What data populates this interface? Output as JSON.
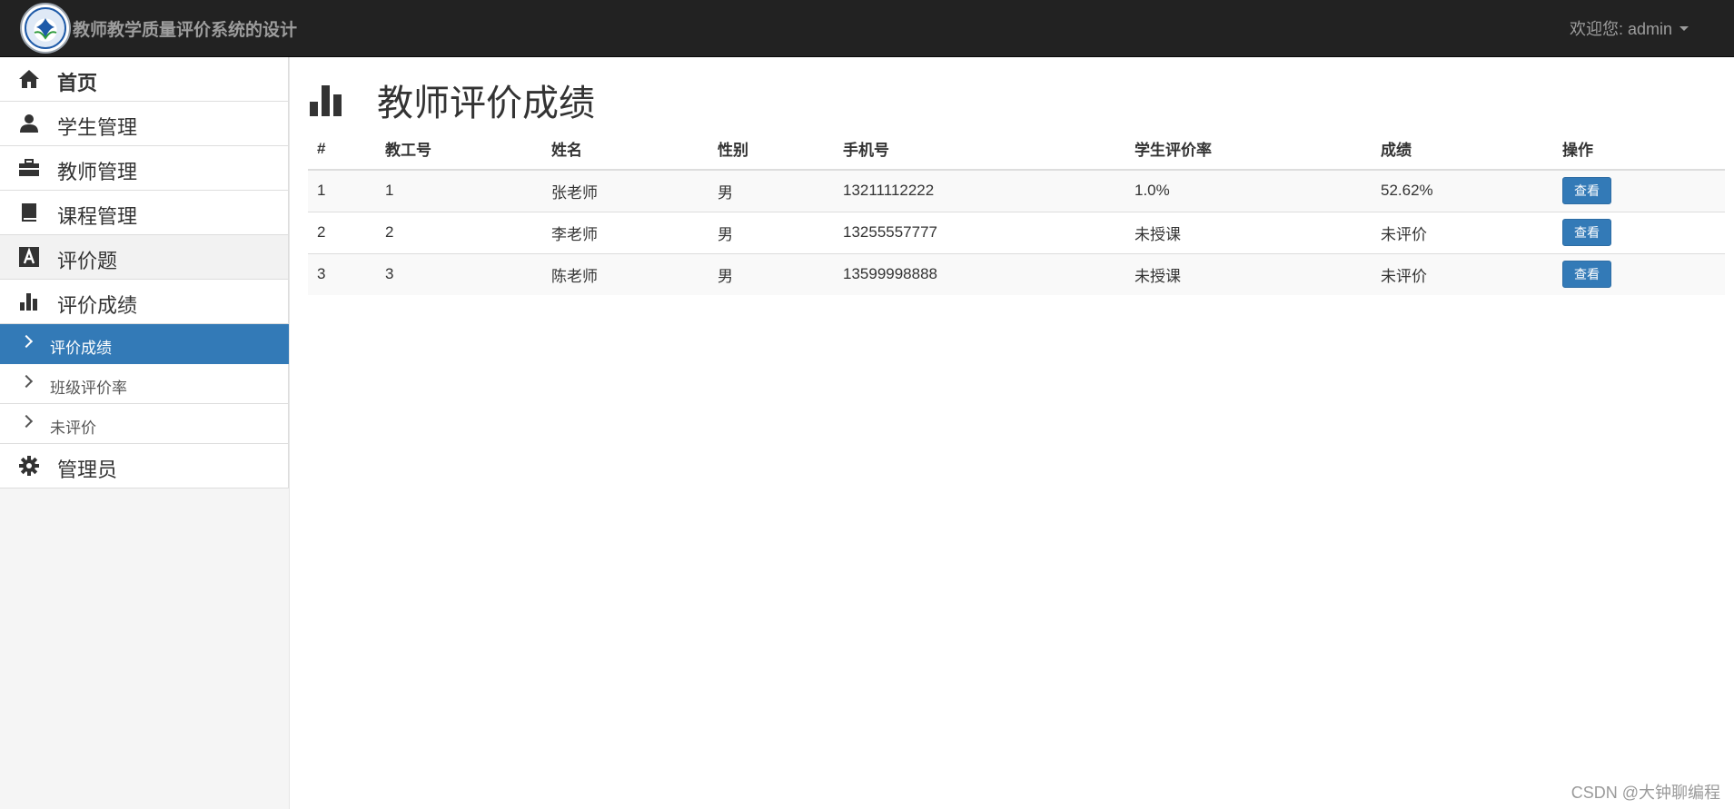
{
  "header": {
    "title": "教师教学质量评价系统的设计",
    "welcome_text": "欢迎您: admin"
  },
  "sidebar": {
    "items": [
      {
        "label": "首页",
        "icon": "home-icon"
      },
      {
        "label": "学生管理",
        "icon": "user-icon"
      },
      {
        "label": "教师管理",
        "icon": "briefcase-icon"
      },
      {
        "label": "课程管理",
        "icon": "book-icon"
      },
      {
        "label": "评价题",
        "icon": "font-icon"
      },
      {
        "label": "评价成绩",
        "icon": "bar-chart-icon"
      }
    ],
    "sub_items": [
      {
        "label": "评价成绩"
      },
      {
        "label": "班级评价率"
      },
      {
        "label": "未评价"
      }
    ],
    "admin_item": {
      "label": "管理员",
      "icon": "gear-icon"
    }
  },
  "main": {
    "title": "教师评价成绩",
    "table": {
      "headers": [
        "#",
        "教工号",
        "姓名",
        "性别",
        "手机号",
        "学生评价率",
        "成绩",
        "操作"
      ],
      "rows": [
        {
          "index": "1",
          "id": "1",
          "name": "张老师",
          "gender": "男",
          "phone": "13211112222",
          "rate": "1.0%",
          "score": "52.62%",
          "action": "查看"
        },
        {
          "index": "2",
          "id": "2",
          "name": "李老师",
          "gender": "男",
          "phone": "13255557777",
          "rate": "未授课",
          "score": "未评价",
          "action": "查看"
        },
        {
          "index": "3",
          "id": "3",
          "name": "陈老师",
          "gender": "男",
          "phone": "13599998888",
          "rate": "未授课",
          "score": "未评价",
          "action": "查看"
        }
      ]
    }
  },
  "watermark": "CSDN @大钟聊编程",
  "colors": {
    "navbar_bg": "#222222",
    "primary": "#337ab7",
    "sidebar_bg": "#f5f5f5"
  }
}
